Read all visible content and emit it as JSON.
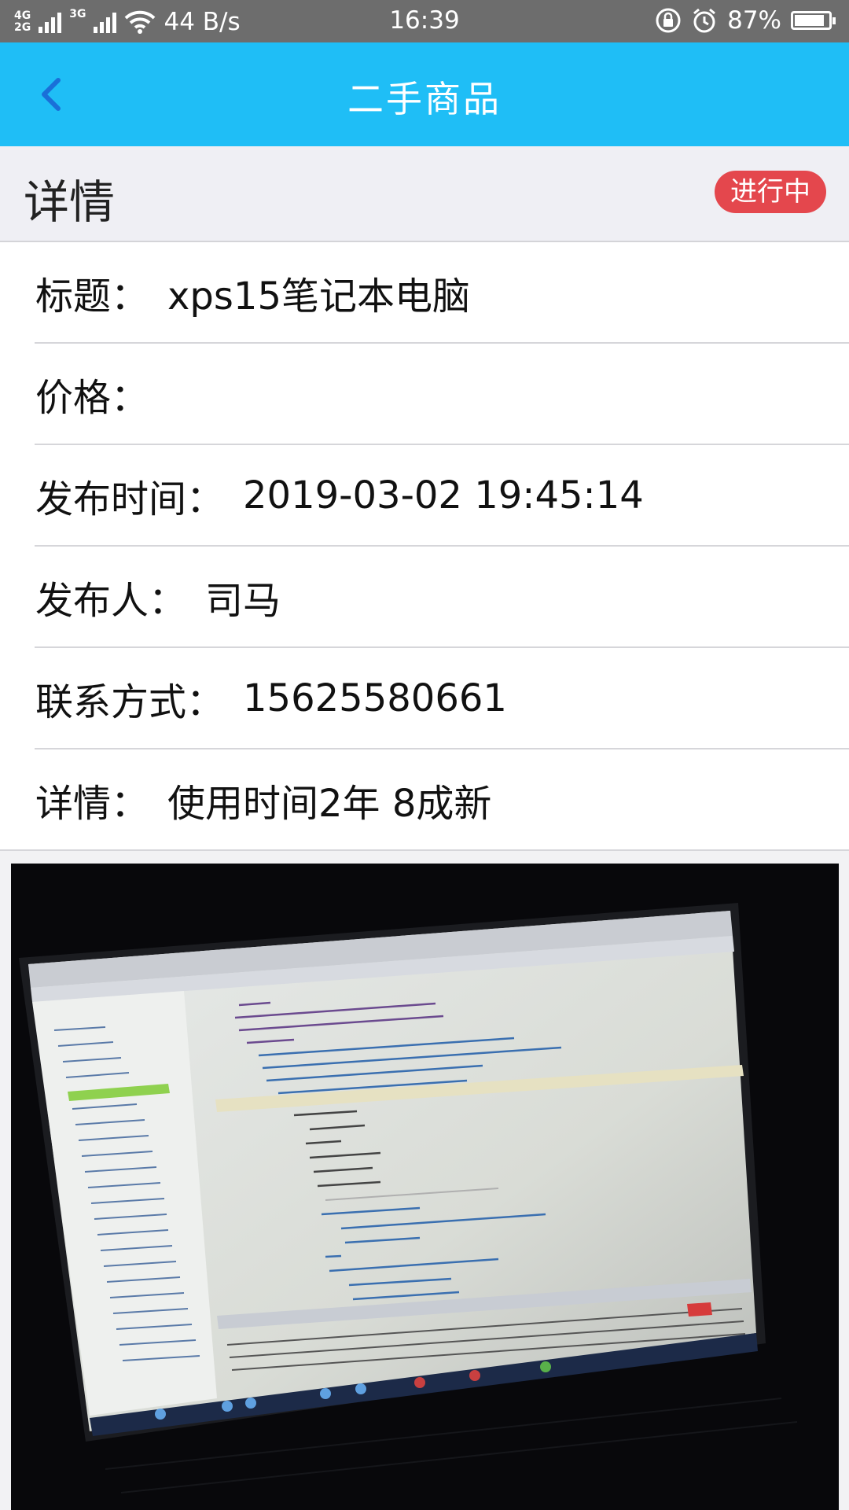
{
  "status_bar": {
    "net_top": "4G",
    "net_bottom": "2G",
    "net_second": "3G",
    "speed": "44 B/s",
    "time": "16:39",
    "battery": "87%",
    "battery_level": 0.87
  },
  "header": {
    "title": "二手商品",
    "back_icon": "chevron-left-icon"
  },
  "section": {
    "title": "详情",
    "status_badge": "进行中"
  },
  "details": [
    {
      "label": "标题：",
      "value": "xps15笔记本电脑"
    },
    {
      "label": "价格：",
      "value": ""
    },
    {
      "label": "发布时间：",
      "value": "2019-03-02 19:45:14"
    },
    {
      "label": "发布人：",
      "value": "司马"
    },
    {
      "label": "联系方式：",
      "value": "15625580661"
    },
    {
      "label": "详情：",
      "value": "使用时间2年 8成新"
    }
  ],
  "colors": {
    "header": "#1fbef6",
    "badge": "#e4474d",
    "back_arrow": "#1a6fd8"
  }
}
